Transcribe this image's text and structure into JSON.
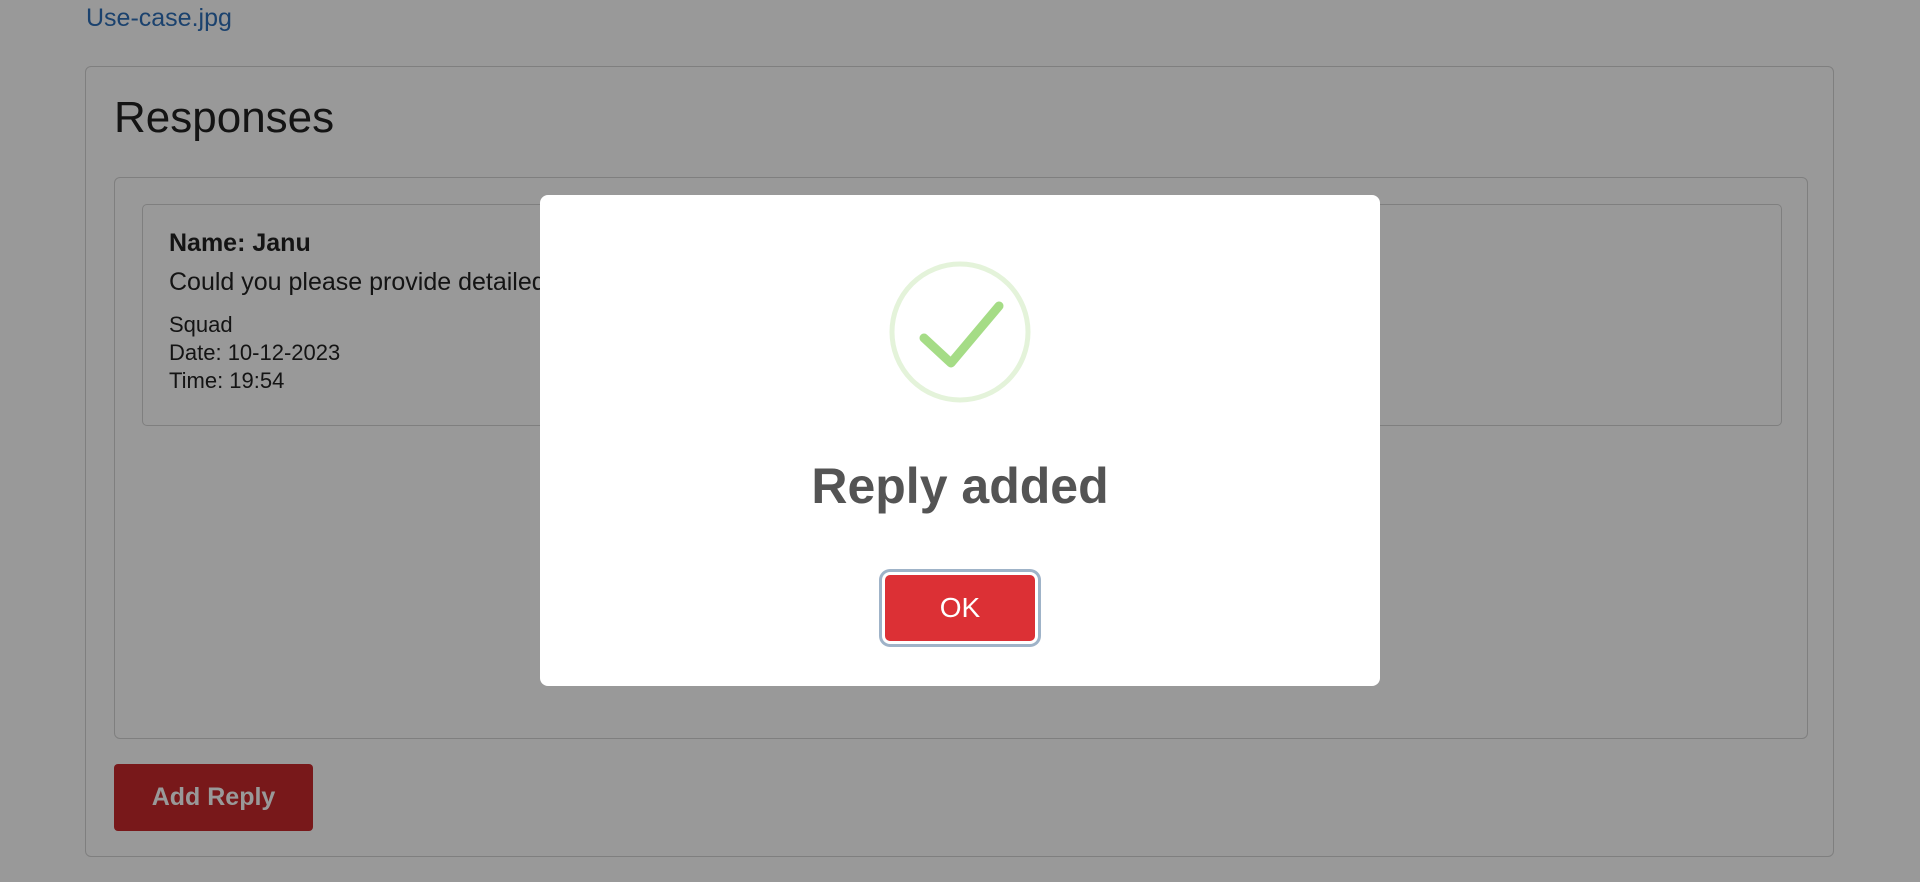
{
  "attachment": {
    "filename": "Use-case.jpg"
  },
  "responses": {
    "title": "Responses",
    "items": [
      {
        "name": "Name: Janu",
        "text": "Could you please provide detailed",
        "squad": "Squad",
        "date": "Date: 10-12-2023",
        "time": "Time: 19:54"
      }
    ],
    "add_reply_label": "Add Reply"
  },
  "modal": {
    "icon": "success-check-icon",
    "title": "Reply added",
    "ok_label": "OK"
  },
  "colors": {
    "link": "#2e6fb7",
    "primary_red": "#dc3035",
    "success_green": "#a5dc86",
    "overlay": "rgba(0,0,0,0.4)"
  }
}
